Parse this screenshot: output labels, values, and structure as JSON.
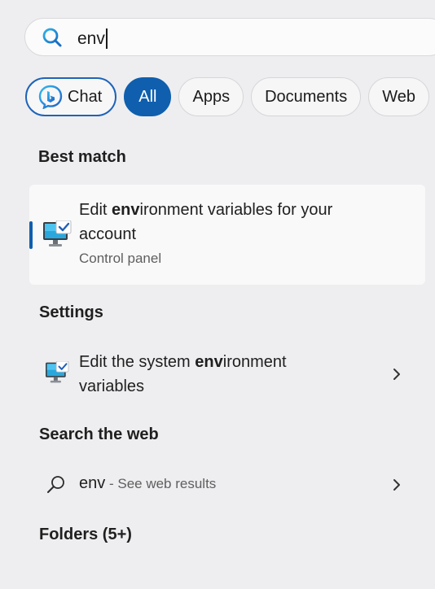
{
  "search": {
    "query": "env"
  },
  "filters": [
    {
      "label": "Chat",
      "state": "outlined"
    },
    {
      "label": "All",
      "state": "active"
    },
    {
      "label": "Apps",
      "state": "normal"
    },
    {
      "label": "Documents",
      "state": "normal"
    },
    {
      "label": "Web",
      "state": "normal"
    }
  ],
  "sections": {
    "best_match": "Best match",
    "settings": "Settings",
    "search_web": "Search the web",
    "folders": "Folders (5+)"
  },
  "best_match_item": {
    "title_prefix": "Edit ",
    "title_highlight": "env",
    "title_rest": "ironment variables for your",
    "title_line2": "account",
    "subtitle": "Control panel",
    "icon": "monitor-check-icon"
  },
  "settings_item": {
    "title_prefix": "Edit the system ",
    "title_highlight": "env",
    "title_rest": "ironment",
    "title_line2": "variables",
    "icon": "monitor-check-icon"
  },
  "web_item": {
    "query": "env",
    "hint": " - See web results",
    "icon": "search-icon"
  },
  "colors": {
    "accent": "#0f5fae",
    "background": "#eeeef0"
  }
}
